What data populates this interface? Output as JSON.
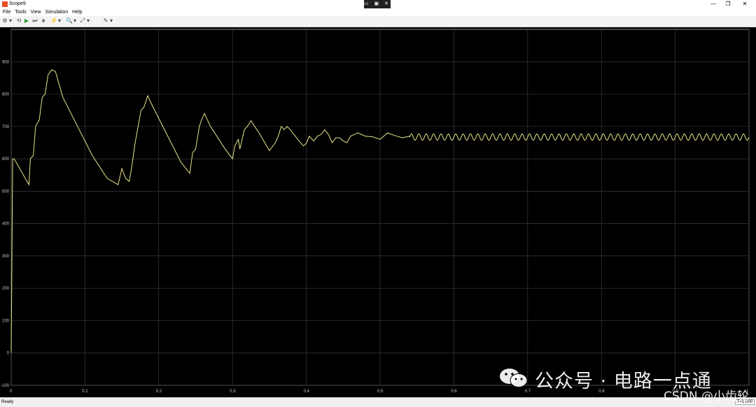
{
  "window": {
    "title": "Scope9",
    "center_controls": "▭ ▣ ✕",
    "minimize": "—",
    "restore": "❐",
    "close": "✕"
  },
  "menu": [
    "File",
    "Tools",
    "View",
    "Simulation",
    "Help"
  ],
  "toolbar": [
    "⚙",
    "▾",
    "⟲",
    "▶",
    "⏭",
    "■",
    "⚡",
    "▾",
    "🔍",
    "▾",
    "⤢",
    "▾",
    "✎",
    "▾"
  ],
  "status": {
    "text": "Ready",
    "time": "T=1.000"
  },
  "watermark": {
    "line1": "公众号 · 电路一点通",
    "line2": "CSDN @小齿轮"
  },
  "colors": {
    "background": "#000000",
    "grid": "#3a3a3a",
    "trace": "#e8e48a",
    "ticks": "#cccccc"
  },
  "chart_data": {
    "type": "line",
    "title": "",
    "xlabel": "",
    "ylabel": "",
    "xlim": [
      0,
      1
    ],
    "ylim": [
      -100,
      1000
    ],
    "xticks": [
      "0",
      "0.1",
      "0.2",
      "0.3",
      "0.4",
      "0.5",
      "0.6",
      "0.7",
      "0.8",
      "0.9",
      "1"
    ],
    "yticks": [
      "-100",
      "0",
      "100",
      "200",
      "300",
      "400",
      "500",
      "600",
      "700",
      "800",
      "900"
    ],
    "grid": true,
    "series": [
      {
        "color": "#e8e48a",
        "x": [
          0,
          0.002,
          0.004,
          0.024,
          0.026,
          0.03,
          0.033,
          0.038,
          0.042,
          0.046,
          0.05,
          0.055,
          0.06,
          0.065,
          0.07,
          0.09,
          0.11,
          0.13,
          0.145,
          0.15,
          0.155,
          0.16,
          0.163,
          0.168,
          0.172,
          0.176,
          0.18,
          0.185,
          0.19,
          0.21,
          0.23,
          0.242,
          0.246,
          0.25,
          0.255,
          0.258,
          0.262,
          0.266,
          0.27,
          0.29,
          0.3,
          0.303,
          0.308,
          0.31,
          0.316,
          0.32,
          0.325,
          0.33,
          0.336,
          0.35,
          0.358,
          0.362,
          0.366,
          0.37,
          0.374,
          0.377,
          0.38,
          0.385,
          0.39,
          0.396,
          0.4,
          0.404,
          0.41,
          0.415,
          0.42,
          0.425,
          0.43,
          0.435,
          0.44,
          0.445,
          0.45,
          0.455,
          0.46,
          0.47,
          0.48,
          0.49,
          0.5,
          0.51,
          0.52,
          0.53,
          0.54
        ],
        "y": [
          0,
          600,
          600,
          520,
          600,
          610,
          700,
          720,
          790,
          800,
          860,
          875,
          870,
          830,
          790,
          700,
          610,
          540,
          520,
          570,
          540,
          530,
          570,
          650,
          700,
          750,
          760,
          795,
          770,
          680,
          590,
          555,
          620,
          630,
          700,
          720,
          740,
          720,
          700,
          630,
          600,
          640,
          660,
          630,
          690,
          700,
          718,
          700,
          680,
          625,
          650,
          670,
          700,
          690,
          700,
          693,
          685,
          670,
          655,
          640,
          648,
          670,
          655,
          670,
          675,
          690,
          675,
          650,
          665,
          665,
          655,
          650,
          670,
          680,
          670,
          668,
          660,
          680,
          672,
          665,
          670
        ]
      }
    ],
    "steady_oscillation": {
      "x_start": 0.54,
      "x_end": 1.0,
      "center": 667,
      "amplitude": 10,
      "period": 0.01
    }
  }
}
